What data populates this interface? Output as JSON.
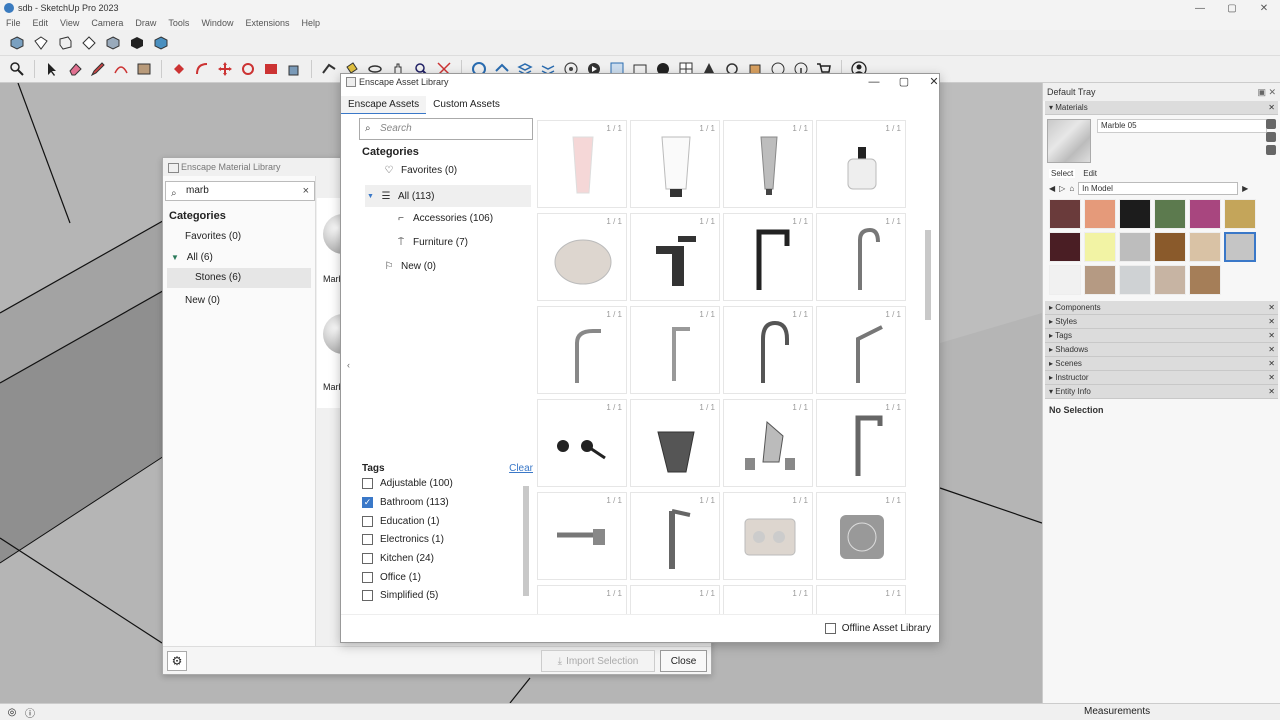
{
  "app": {
    "title": "sdb - SketchUp Pro 2023",
    "menu": [
      "File",
      "Edit",
      "View",
      "Camera",
      "Draw",
      "Tools",
      "Window",
      "Extensions",
      "Help"
    ],
    "window_controls": [
      "—",
      "▢",
      "✕"
    ]
  },
  "status": {
    "measurements_label": "Measurements"
  },
  "tray": {
    "title": "Default Tray",
    "materials_label": "Materials",
    "material_name": "Marble 05",
    "select_tab": "Select",
    "edit_tab": "Edit",
    "in_model": "In Model",
    "swatches": [
      "#6a3b3b",
      "#e59a7a",
      "#1c1c1c",
      "#5c7a4e",
      "#a8467f",
      "#c4a55a",
      "#4a1e24",
      "#f2f3a4",
      "#bdbdbd",
      "#8a5a2b",
      "#d9c2a5",
      "#c5c5c5",
      "#f1f1f1",
      "#b59a83",
      "#cfd2d4",
      "#c7b4a3",
      "#a57e58"
    ],
    "panels": [
      "Components",
      "Styles",
      "Tags",
      "Shadows",
      "Scenes",
      "Instructor",
      "Entity Info"
    ],
    "entity_info_text": "No Selection"
  },
  "material_library": {
    "title": "Enscape Material Library",
    "search_value": "marb",
    "categories_label": "Categories",
    "favorites": "Favorites (0)",
    "all": "All (6)",
    "stones": "Stones (6)",
    "new": "New (0)",
    "thumb_label_1": "Marb",
    "thumb_label_2": "Marb",
    "import_button": "Import Selection",
    "close_button": "Close"
  },
  "asset_library": {
    "title": "Enscape Asset Library",
    "tabs": [
      "Enscape Assets",
      "Custom Assets"
    ],
    "search_placeholder": "Search",
    "categories_label": "Categories",
    "favorites": "Favorites (0)",
    "all": "All (113)",
    "accessories": "Accessories (106)",
    "furniture": "Furniture (7)",
    "new": "New (0)",
    "tags_label": "Tags",
    "clear_label": "Clear",
    "tags": [
      {
        "label": "Adjustable (100)",
        "checked": false
      },
      {
        "label": "Bathroom (113)",
        "checked": true
      },
      {
        "label": "Education (1)",
        "checked": false
      },
      {
        "label": "Electronics (1)",
        "checked": false
      },
      {
        "label": "Kitchen (24)",
        "checked": false
      },
      {
        "label": "Office (1)",
        "checked": false
      },
      {
        "label": "Simplified (5)",
        "checked": false
      }
    ],
    "tile_count": "1 / 1",
    "offline_label": "Offline Asset Library"
  }
}
